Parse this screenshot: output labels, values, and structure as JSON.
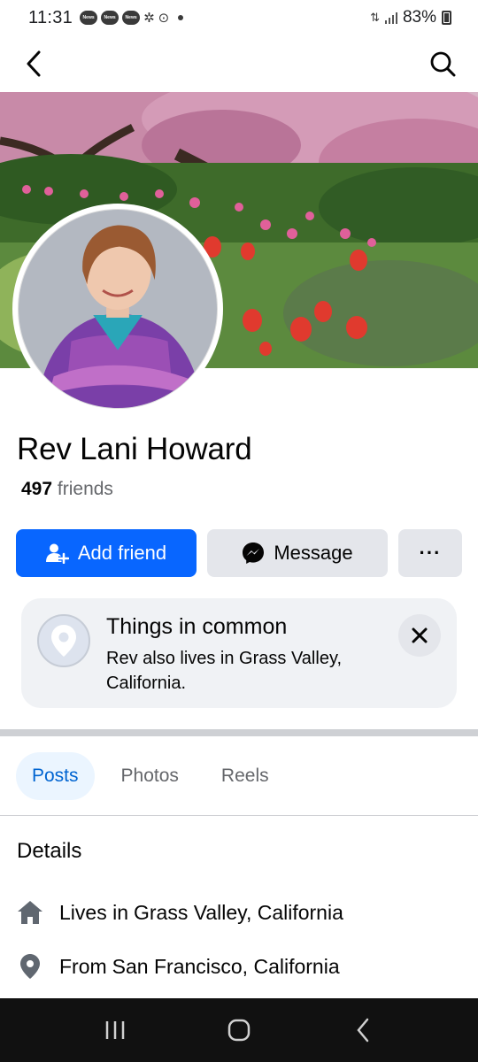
{
  "status_bar": {
    "time": "11:31",
    "news_badges": [
      "News",
      "News",
      "News"
    ],
    "battery": "83%"
  },
  "header": {
    "back_icon": "chevron-left-icon",
    "search_icon": "search-icon"
  },
  "profile": {
    "name": "Rev Lani Howard",
    "friends_count": "497",
    "friends_label": "friends"
  },
  "actions": {
    "add_friend_label": "Add friend",
    "message_label": "Message",
    "more_label": "···"
  },
  "common": {
    "title": "Things in common",
    "text": "Rev also lives in Grass Valley, California."
  },
  "tabs": [
    {
      "label": "Posts",
      "active": true
    },
    {
      "label": "Photos",
      "active": false
    },
    {
      "label": "Reels",
      "active": false
    }
  ],
  "details": {
    "title": "Details",
    "lives_prefix": "Lives in",
    "lives_value": "Grass Valley, California",
    "from_prefix": "From",
    "from_value": "San Francisco, California"
  },
  "colors": {
    "primary": "#0866ff",
    "secondary_button": "#e4e6eb",
    "active_tab_bg": "#ebf5ff",
    "active_tab_text": "#0064d1"
  }
}
